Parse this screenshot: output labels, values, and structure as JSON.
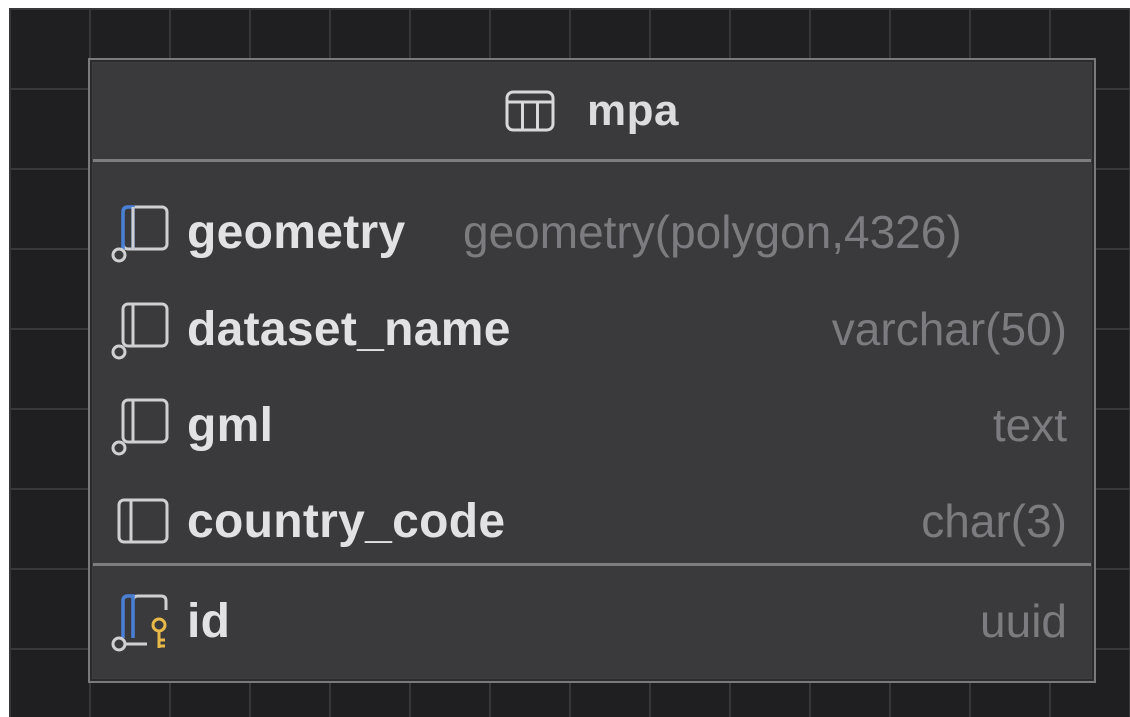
{
  "table": {
    "name": "mpa",
    "icon": "table-icon"
  },
  "columns": [
    {
      "name": "geometry",
      "type": "geometry(polygon,4326)",
      "icon": "column-not-null-indexed-icon"
    },
    {
      "name": "dataset_name",
      "type": "varchar(50)",
      "icon": "column-indexed-icon"
    },
    {
      "name": "gml",
      "type": "text",
      "icon": "column-indexed-icon"
    },
    {
      "name": "country_code",
      "type": "char(3)",
      "icon": "column-icon"
    }
  ],
  "primary_keys": [
    {
      "name": "id",
      "type": "uuid",
      "icon": "primary-key-column-icon"
    }
  ],
  "colors": {
    "canvas": "#1f1f21",
    "grid": "#38383a",
    "entity_bg": "#3a3a3c",
    "border": "#7a7a7d",
    "name_text": "#e2e2e4",
    "type_text": "#7c7c80",
    "not_null_accent": "#4a7fd6",
    "key_accent": "#e8b949"
  }
}
